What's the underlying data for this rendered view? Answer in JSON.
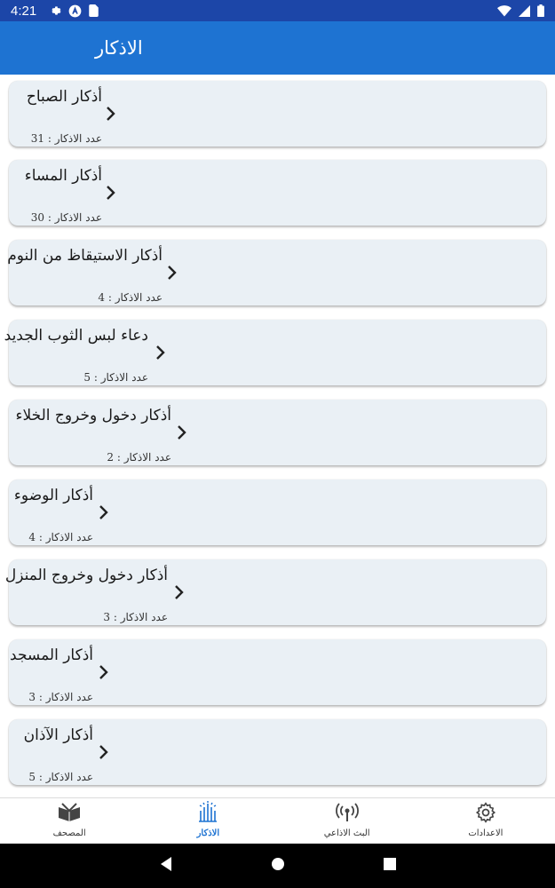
{
  "status_bar": {
    "time": "4:21",
    "left_icons": [
      "gear-icon",
      "app-badge-icon",
      "sim-card-icon"
    ],
    "right_icons": [
      "wifi-icon",
      "signal-icon",
      "battery-icon"
    ]
  },
  "app_bar": {
    "title": "الاذكار"
  },
  "list": {
    "items": [
      {
        "title": "أذكار الصباح",
        "count": "عدد الاذكار : 31"
      },
      {
        "title": "أذكار المساء",
        "count": "عدد الاذكار : 30"
      },
      {
        "title": "أذكار الاستيقاظ من النوم",
        "count": "عدد الاذكار : 4"
      },
      {
        "title": "دعاء لبس الثوب الجديد",
        "count": "عدد الاذكار : 5"
      },
      {
        "title": "أذكار دخول وخروج الخلاء",
        "count": "عدد الاذكار : 2"
      },
      {
        "title": "أذكار الوضوء",
        "count": "عدد الاذكار : 4"
      },
      {
        "title": "أذكار دخول وخروج المنزل",
        "count": "عدد الاذكار : 3"
      },
      {
        "title": "أذكار المسجد",
        "count": "عدد الاذكار : 3"
      },
      {
        "title": "أذكار الآذان",
        "count": "عدد الاذكار : 5"
      }
    ]
  },
  "bottom_nav": {
    "items": [
      {
        "label": "المصحف",
        "icon": "quran-book-icon",
        "active": false
      },
      {
        "label": "الاذكار",
        "icon": "prayer-hands-icon",
        "active": true
      },
      {
        "label": "البث الاذاعي",
        "icon": "radio-broadcast-icon",
        "active": false
      },
      {
        "label": "الاعدادات",
        "icon": "settings-gear-icon",
        "active": false
      }
    ]
  },
  "colors": {
    "status_bar": "#1c46a8",
    "app_bar": "#1e73d2",
    "card_bg": "#eaf0f5",
    "active_nav": "#1e73d2"
  },
  "system_nav": {
    "icons": [
      "back-icon",
      "home-icon",
      "recents-icon"
    ]
  }
}
